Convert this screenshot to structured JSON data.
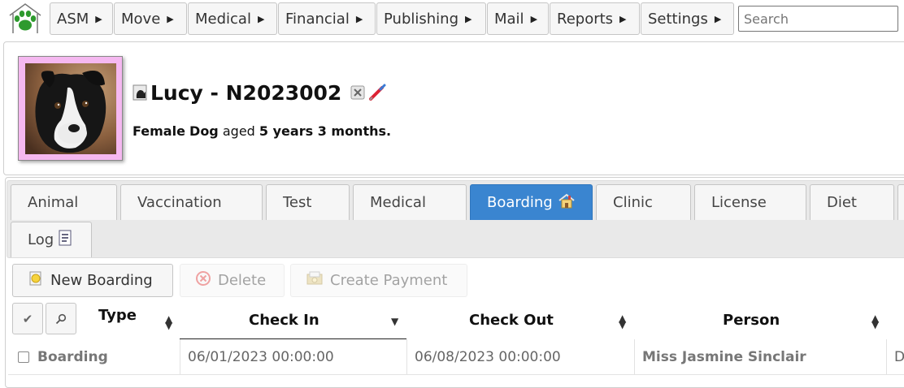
{
  "menu": {
    "home_icon": "paw-icon",
    "items": [
      {
        "label": "ASM"
      },
      {
        "label": "Move"
      },
      {
        "label": "Medical"
      },
      {
        "label": "Financial"
      },
      {
        "label": "Publishing"
      },
      {
        "label": "Mail"
      },
      {
        "label": "Reports"
      },
      {
        "label": "Settings"
      }
    ],
    "search_placeholder": "Search"
  },
  "animal": {
    "title": "Lucy - N2023002",
    "sex": "Female",
    "species": "Dog",
    "aged_label": "aged",
    "age": "5 years 3 months."
  },
  "tabs": {
    "items": [
      {
        "label": "Animal"
      },
      {
        "label": "Vaccination"
      },
      {
        "label": "Test"
      },
      {
        "label": "Medical"
      },
      {
        "label": "Boarding",
        "active": true
      },
      {
        "label": "Clinic"
      },
      {
        "label": "License"
      },
      {
        "label": "Diet"
      },
      {
        "label": "Log"
      }
    ]
  },
  "toolbar": {
    "new_label": "New Boarding",
    "delete_label": "Delete",
    "payment_label": "Create Payment"
  },
  "table": {
    "columns": [
      {
        "label": "Type"
      },
      {
        "label": "Check In"
      },
      {
        "label": "Check Out"
      },
      {
        "label": "Person"
      }
    ],
    "rows": [
      {
        "type": "Boarding",
        "check_in": "06/01/2023 00:00:00",
        "check_out": "06/08/2023 00:00:00",
        "person": "Miss Jasmine Sinclair",
        "overflow": "D"
      }
    ]
  },
  "colors": {
    "active_tab": "#3a85d0",
    "photo_frame": "#f5b8f0",
    "paw": "#2e9a2e"
  }
}
